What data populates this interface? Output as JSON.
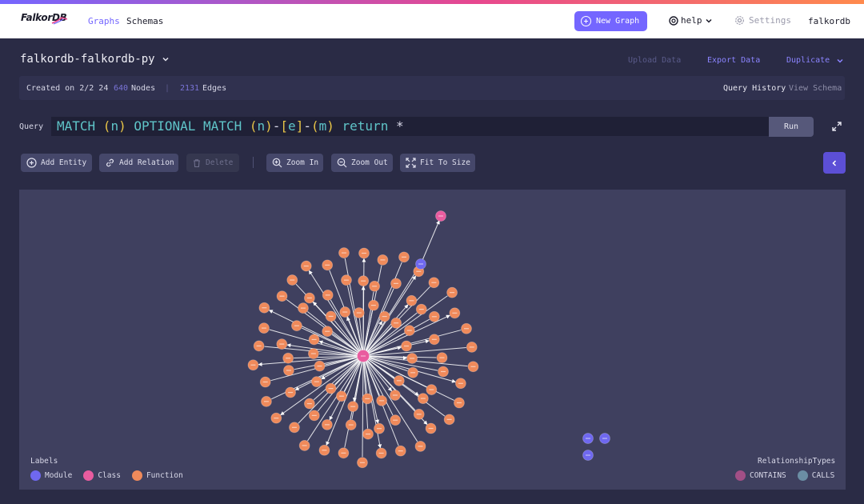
{
  "app": {
    "logo": "FalkorDB",
    "nav": {
      "graphs": "Graphs",
      "schemas": "Schemas"
    },
    "new_graph": "New Graph",
    "help": "help",
    "settings": "Settings",
    "user": "falkordb"
  },
  "graph": {
    "name": "falkordb-falkordb-py",
    "actions": {
      "upload": "Upload Data",
      "export": "Export Data",
      "duplicate": "Duplicate"
    },
    "info": {
      "created": "Created on 2/2 24",
      "nodes_count": "640",
      "nodes_label": "Nodes",
      "separator": "|",
      "edges_count": "2131",
      "edges_label": "Edges",
      "query_history": "Query History",
      "view_schema": "View Schema"
    }
  },
  "query": {
    "label": "Query",
    "tokens": [
      {
        "t": "MATCH ",
        "c": "kw"
      },
      {
        "t": "(",
        "c": "par"
      },
      {
        "t": "n",
        "c": "var"
      },
      {
        "t": ")",
        "c": "par"
      },
      {
        "t": " OPTIONAL MATCH ",
        "c": "kw"
      },
      {
        "t": "(",
        "c": "par"
      },
      {
        "t": "n",
        "c": "var"
      },
      {
        "t": ")",
        "c": "par"
      },
      {
        "t": "-",
        "c": "plain"
      },
      {
        "t": "[",
        "c": "par"
      },
      {
        "t": "e",
        "c": "var"
      },
      {
        "t": "]",
        "c": "par"
      },
      {
        "t": "-",
        "c": "plain"
      },
      {
        "t": "(",
        "c": "par"
      },
      {
        "t": "m",
        "c": "var"
      },
      {
        "t": ")",
        "c": "par"
      },
      {
        "t": " return ",
        "c": "kw"
      },
      {
        "t": "*",
        "c": "plain"
      }
    ],
    "run": "Run"
  },
  "toolbar": {
    "add_entity": "Add Entity",
    "add_relation": "Add Relation",
    "delete": "Delete",
    "zoom_in": "Zoom In",
    "zoom_out": "Zoom Out",
    "fit": "Fit To Size"
  },
  "legend": {
    "labels_title": "Labels",
    "labels": [
      {
        "name": "Module",
        "color": "#6f68f0"
      },
      {
        "name": "Class",
        "color": "#e95c9f"
      },
      {
        "name": "Function",
        "color": "#ef8a5b"
      }
    ],
    "rel_title": "RelationshipTypes",
    "relationships": [
      {
        "name": "CONTAINS",
        "color": "#a24f86"
      },
      {
        "name": "CALLS",
        "color": "#6b8ea4"
      }
    ]
  },
  "colors": {
    "accent": "#7466ff",
    "module": "#6f68f0",
    "class": "#e95c9f",
    "function": "#ef8a5b",
    "edge": "#ffffff"
  }
}
